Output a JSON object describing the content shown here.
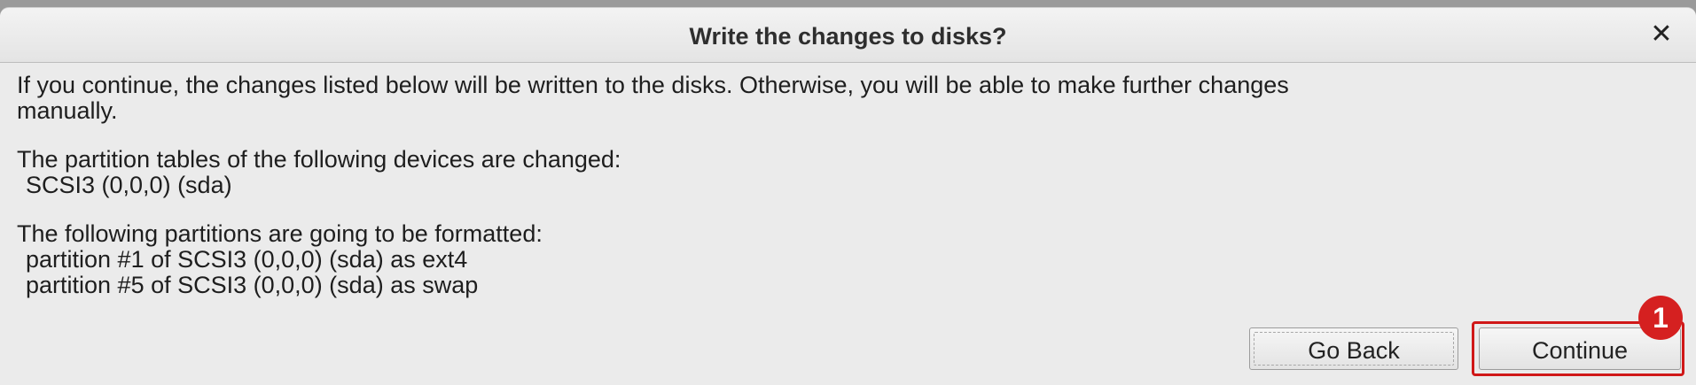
{
  "dialog": {
    "title": "Write the changes to disks?",
    "close_symbol": "✕",
    "intro_line1": "If you continue, the changes listed below will be written to the disks. Otherwise, you will be able to make further changes",
    "intro_line2": "manually.",
    "partition_tables_heading": "The partition tables of the following devices are changed:",
    "partition_tables_devices": [
      "SCSI3 (0,0,0) (sda)"
    ],
    "formatted_heading": "The following partitions are going to be formatted:",
    "formatted_partitions": [
      "partition #1 of SCSI3 (0,0,0) (sda) as ext4",
      "partition #5 of SCSI3 (0,0,0) (sda) as swap"
    ]
  },
  "buttons": {
    "go_back": "Go Back",
    "continue": "Continue"
  },
  "annotation": {
    "step_number": "1",
    "color": "#d01818"
  },
  "icons": {
    "close": "close-icon"
  }
}
